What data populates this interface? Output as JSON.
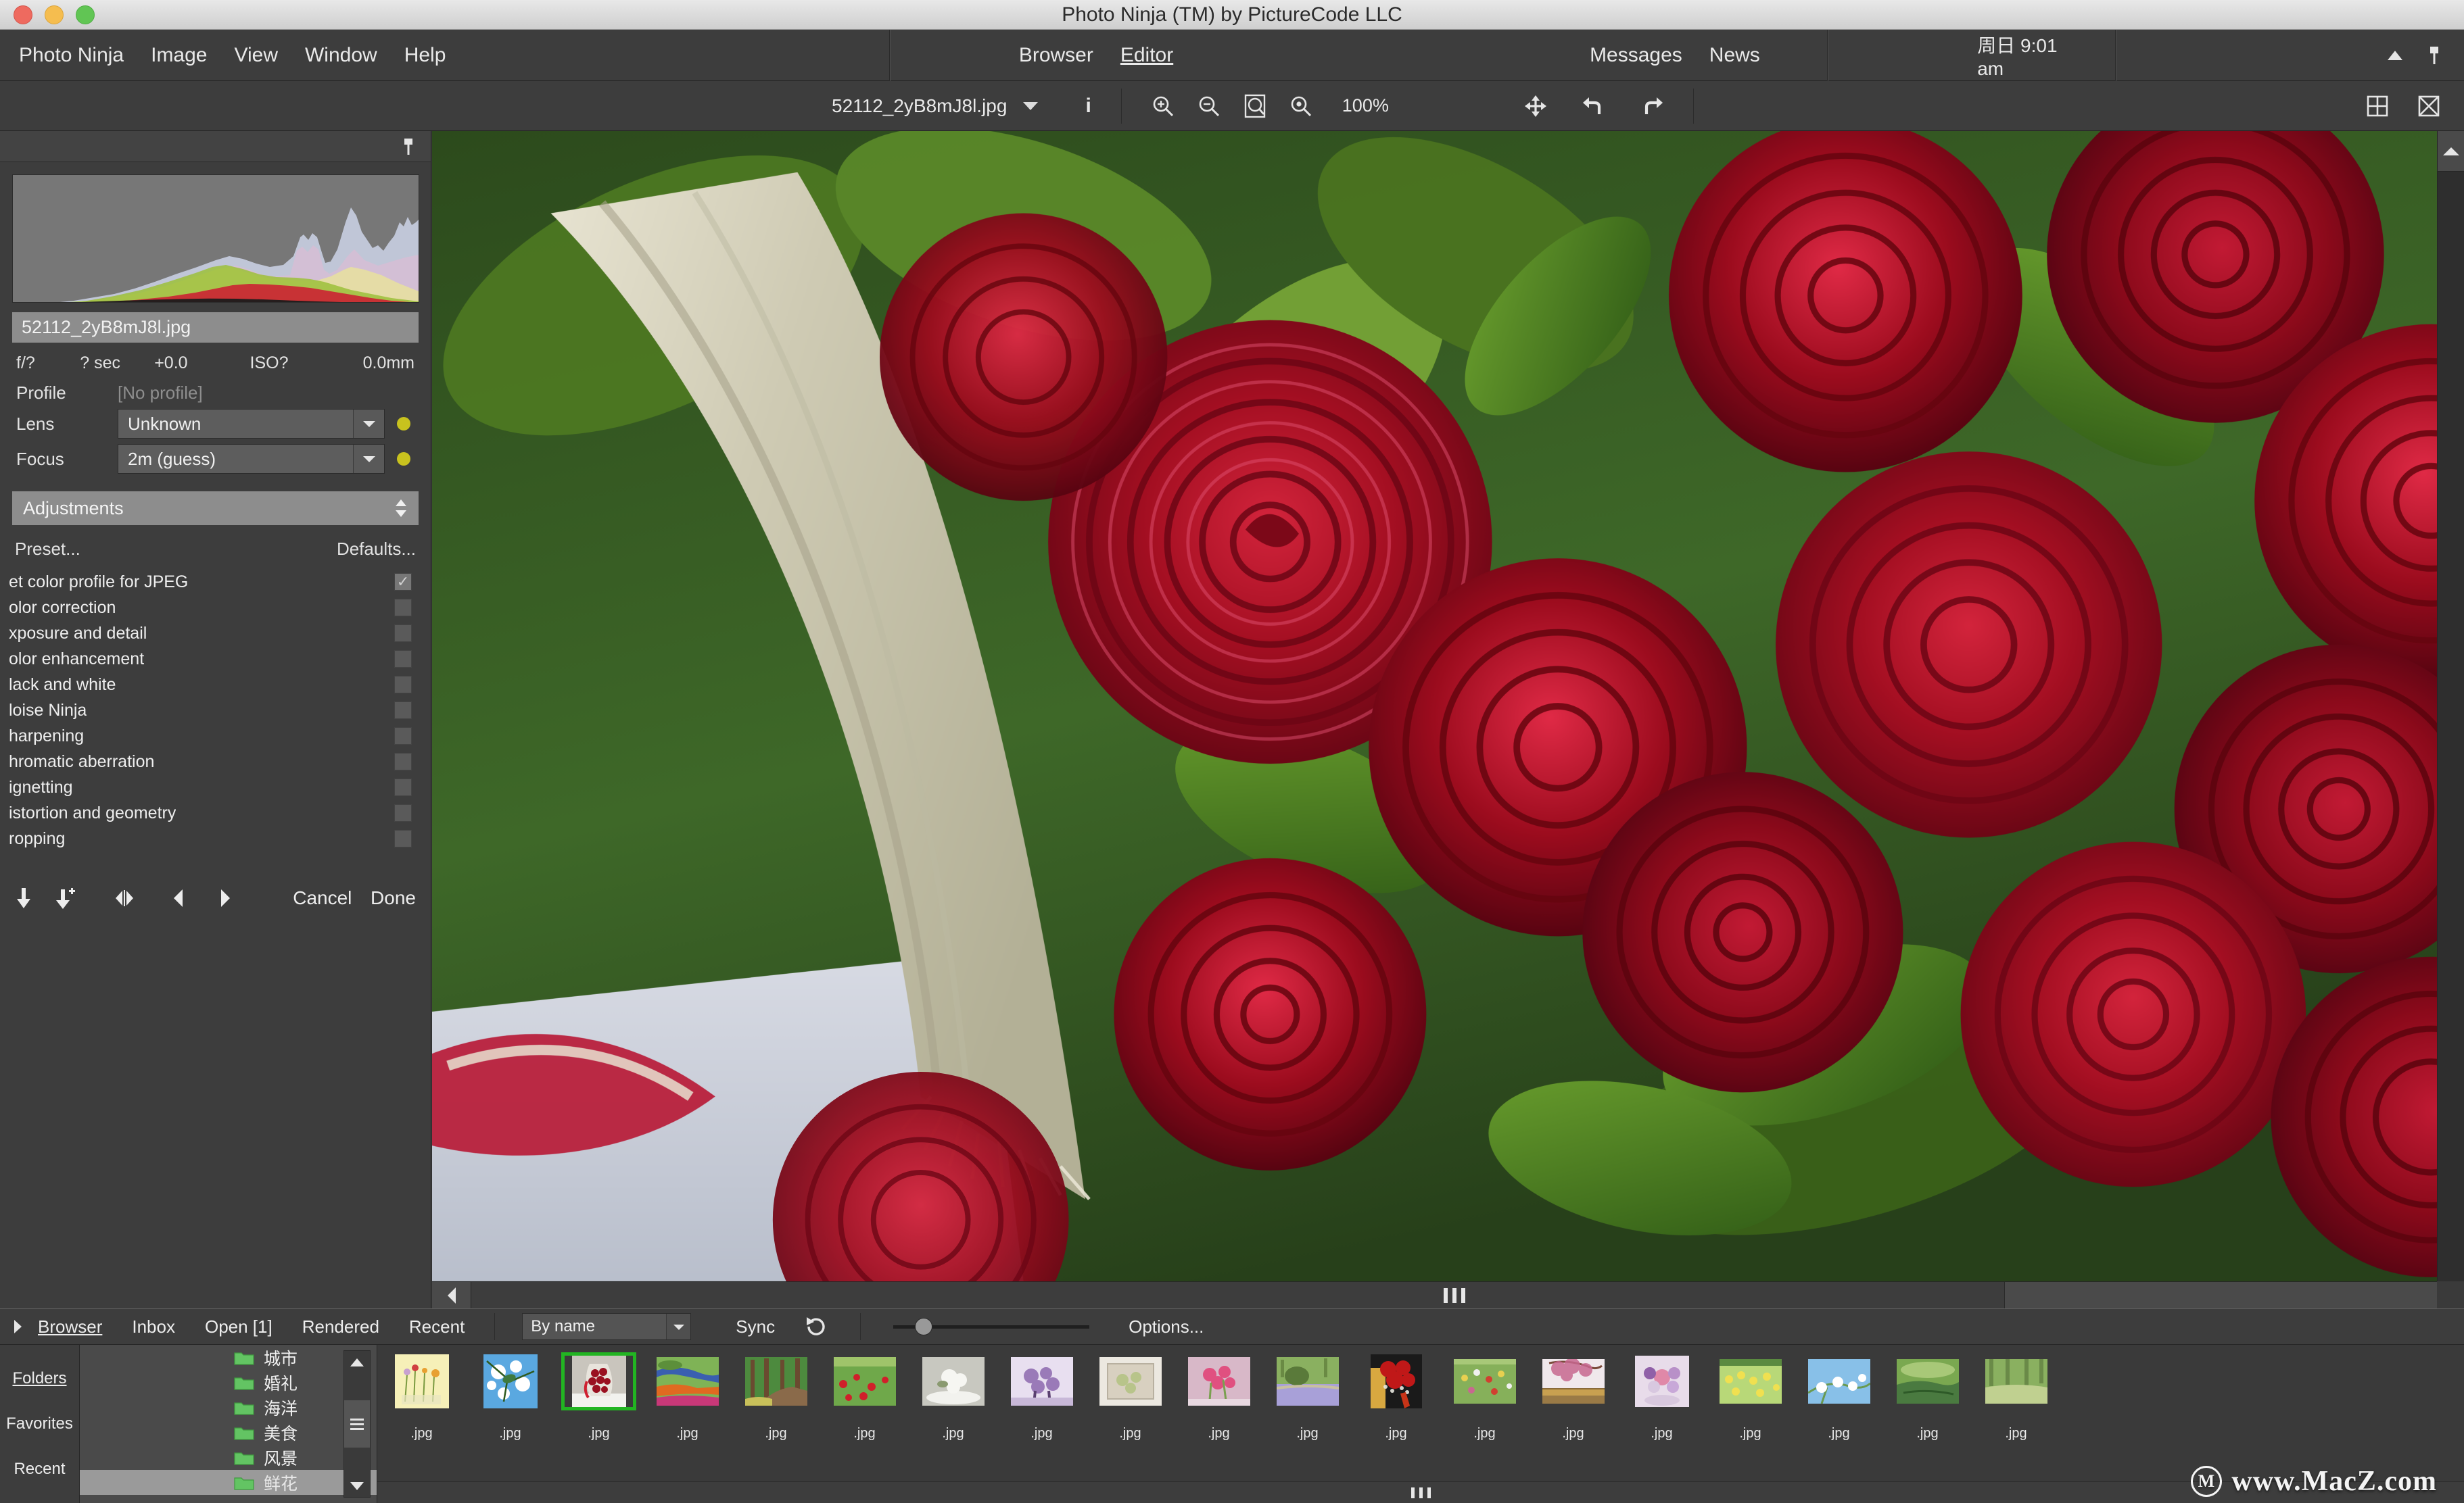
{
  "window": {
    "title": "Photo Ninja (TM) by PictureCode LLC",
    "traffic_lights": [
      "close",
      "minimize",
      "zoom"
    ]
  },
  "menubar": {
    "left_items": [
      "Photo Ninja",
      "Image",
      "View",
      "Window",
      "Help"
    ],
    "center_items": [
      {
        "label": "Browser",
        "active": false
      },
      {
        "label": "Editor",
        "active": true
      }
    ],
    "right_items": [
      "Messages",
      "News"
    ],
    "clock": "周日 9:01 am",
    "icons": [
      "triangle-up-icon",
      "pin-icon"
    ]
  },
  "toolbar": {
    "filename": "52112_2yB8mJ8l.jpg",
    "dropdown_icon": "chevron-down-icon",
    "info_icon": "info-icon",
    "zoom_icons": [
      "zoom-in-icon",
      "zoom-out-icon",
      "fit-to-window-icon",
      "zoom-actual-icon"
    ],
    "zoom_level": "100%",
    "nav_icons": [
      "pan-tool-icon",
      "rotate-left-icon",
      "rotate-right-icon"
    ],
    "right_icons": [
      "grid-view-icon",
      "close-view-icon"
    ]
  },
  "sidebar": {
    "pin_icon": "pin-icon",
    "histogram": {
      "title": "RGB Histogram",
      "background": "#777777"
    },
    "metadata": {
      "filename": "52112_2yB8mJ8l.jpg",
      "exif": [
        "f/?",
        "? sec",
        "+0.0",
        "ISO?",
        "0.0mm"
      ],
      "profile_label": "Profile",
      "profile_value": "[No profile]",
      "lens_label": "Lens",
      "lens_value": "Unknown",
      "focus_label": "Focus",
      "focus_value": "2m (guess)",
      "led_color": "#c8c21e"
    },
    "adjustments": {
      "header": "Adjustments",
      "header_icon": "sort-updown-icon",
      "preset_label": "Preset...",
      "defaults_label": "Defaults...",
      "items": [
        {
          "label": "et color profile for JPEG",
          "checked": true
        },
        {
          "label": "olor correction",
          "checked": false
        },
        {
          "label": "xposure and detail",
          "checked": false
        },
        {
          "label": "olor enhancement",
          "checked": false
        },
        {
          "label": "lack and white",
          "checked": false
        },
        {
          "label": "loise Ninja",
          "checked": false
        },
        {
          "label": "harpening",
          "checked": false
        },
        {
          "label": "hromatic aberration",
          "checked": false
        },
        {
          "label": "ignetting",
          "checked": false
        },
        {
          "label": "istortion and geometry",
          "checked": false
        },
        {
          "label": "ropping",
          "checked": false
        }
      ],
      "buttons": {
        "icons": [
          "download-icon",
          "download-plus-icon",
          "compare-icon",
          "previous-icon",
          "next-icon"
        ],
        "cancel_label": "Cancel",
        "done_label": "Done"
      }
    }
  },
  "canvas": {
    "image_description": "Close-up bouquet of red roses wrapped in burlap with green leaves",
    "vscroll_icon": "scroll-up-icon",
    "hscroll_left_icon": "scroll-left-icon",
    "grip_icon": "resize-grip-icon"
  },
  "browser_bar": {
    "expand_icon": "triangle-right-icon",
    "tabs": [
      {
        "label": "Browser",
        "active": true
      },
      {
        "label": "Inbox",
        "active": false
      },
      {
        "label": "Open [1]",
        "active": false
      },
      {
        "label": "Rendered",
        "active": false
      },
      {
        "label": "Recent",
        "active": false
      }
    ],
    "sort_value": "By name",
    "sort_icon": "chevron-down-icon",
    "sync_label": "Sync",
    "refresh_icon": "refresh-icon",
    "zoom_slider_value": 12,
    "options_label": "Options..."
  },
  "bottom_panel": {
    "nav": [
      {
        "label": "Folders",
        "active": true
      },
      {
        "label": "Favorites",
        "active": false
      },
      {
        "label": "Recent",
        "active": false
      }
    ],
    "folders": [
      {
        "name": "城市",
        "selected": false
      },
      {
        "name": "婚礼",
        "selected": false
      },
      {
        "name": "海洋",
        "selected": false
      },
      {
        "name": "美食",
        "selected": false
      },
      {
        "name": "风景",
        "selected": false
      },
      {
        "name": "鲜花",
        "selected": true
      }
    ],
    "folder_icon": "folder-icon",
    "folder_color": "#63c463",
    "scroll_up_icon": "scroll-up-icon",
    "scroll_down_icon": "scroll-down-icon",
    "thumbnails": [
      {
        "label": ".jpg",
        "selected": false,
        "kind": "vases-yellow",
        "c1": "#f6f0b8",
        "c2": "#c9cf7f",
        "c3": "#e8a030"
      },
      {
        "label": ".jpg",
        "selected": false,
        "kind": "white-blossom-sky",
        "c1": "#5aa8e0",
        "c2": "#ffffff",
        "c3": "#3f7a3f"
      },
      {
        "label": ".jpg",
        "selected": true,
        "kind": "red-rose-bouquet",
        "c1": "#e8e4dc",
        "c2": "#9a1020",
        "c3": "#cf2030"
      },
      {
        "label": ".jpg",
        "selected": false,
        "kind": "tulip-field",
        "c1": "#7fb356",
        "c2": "#e06a20",
        "c3": "#3a5fb0"
      },
      {
        "label": ".jpg",
        "selected": false,
        "kind": "forest-path",
        "c1": "#4d8a3e",
        "c2": "#8a6a4a",
        "c3": "#c8c05a"
      },
      {
        "label": ".jpg",
        "selected": false,
        "kind": "poppy-field",
        "c1": "#6fa84a",
        "c2": "#d0202a",
        "c3": "#9fc46a"
      },
      {
        "label": ".jpg",
        "selected": false,
        "kind": "white-bouquet-table",
        "c1": "#c8c8c0",
        "c2": "#f2f2ee",
        "c3": "#8a8a80"
      },
      {
        "label": ".jpg",
        "selected": false,
        "kind": "purple-bouquet",
        "c1": "#9a7ab8",
        "c2": "#e8dff0",
        "c3": "#5a4070"
      },
      {
        "label": ".jpg",
        "selected": false,
        "kind": "white-wall-flowers",
        "c1": "#ece8e0",
        "c2": "#b8c48a",
        "c3": "#d8d0c0"
      },
      {
        "label": ".jpg",
        "selected": false,
        "kind": "pink-tulips-vase",
        "c1": "#d8b8c8",
        "c2": "#e05080",
        "c3": "#7aa050"
      },
      {
        "label": ".jpg",
        "selected": false,
        "kind": "garden-topiary",
        "c1": "#8ab060",
        "c2": "#a8a0d8",
        "c3": "#5a7a3a"
      },
      {
        "label": ".jpg",
        "selected": false,
        "kind": "red-roses-ribbon",
        "c1": "#c01818",
        "c2": "#1a1a1a",
        "c3": "#d8c840"
      },
      {
        "label": ".jpg",
        "selected": false,
        "kind": "wildflower-meadow",
        "c1": "#86b05a",
        "c2": "#e8d050",
        "c3": "#d04030"
      },
      {
        "label": ".jpg",
        "selected": false,
        "kind": "cherry-blossom-tree",
        "c1": "#f0d8e0",
        "c2": "#c86890",
        "c3": "#c8a050"
      },
      {
        "label": ".jpg",
        "selected": false,
        "kind": "pastel-bouquet",
        "c1": "#e8dcea",
        "c2": "#e088a8",
        "c3": "#9060a8"
      },
      {
        "label": ".jpg",
        "selected": false,
        "kind": "daffodil-field",
        "c1": "#b8d878",
        "c2": "#f0e050",
        "c3": "#5a8a40"
      },
      {
        "label": ".jpg",
        "selected": false,
        "kind": "spring-branch-blue",
        "c1": "#88c0e8",
        "c2": "#ffffff",
        "c3": "#6a9a50"
      },
      {
        "label": ".jpg",
        "selected": false,
        "kind": "green-pond",
        "c1": "#7aa850",
        "c2": "#4a7a40",
        "c3": "#a8c878"
      },
      {
        "label": ".jpg",
        "selected": false,
        "kind": "forest-clearing",
        "c1": "#8ab060",
        "c2": "#6a8a48",
        "c3": "#c0d090"
      }
    ]
  },
  "watermark": {
    "logo": "M",
    "text": "www.MacZ.com"
  }
}
